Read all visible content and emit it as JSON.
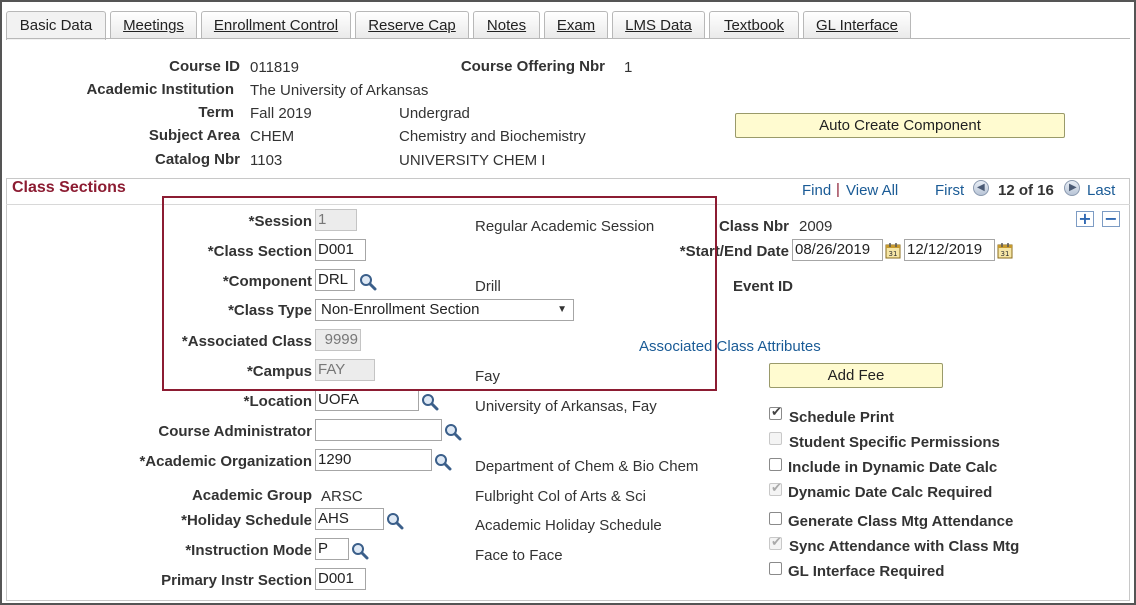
{
  "tabs": [
    {
      "label": "Basic Data",
      "active": true
    },
    {
      "label": "Meetings",
      "active": false
    },
    {
      "label": "Enrollment Control",
      "active": false
    },
    {
      "label": "Reserve Cap",
      "active": false
    },
    {
      "label": "Notes",
      "active": false
    },
    {
      "label": "Exam",
      "active": false
    },
    {
      "label": "LMS Data",
      "active": false
    },
    {
      "label": "Textbook",
      "active": false
    },
    {
      "label": "GL Interface",
      "active": false
    }
  ],
  "header": {
    "course_id_label": "Course ID",
    "course_id": "011819",
    "offering_label": "Course Offering Nbr",
    "offering": "1",
    "institution_label": "Academic Institution",
    "institution": "The University of Arkansas",
    "term_label": "Term",
    "term": "Fall 2019",
    "career": "Undergrad",
    "subject_label": "Subject Area",
    "subject": "CHEM",
    "subject_desc": "Chemistry and Biochemistry",
    "catalog_label": "Catalog Nbr",
    "catalog": "1103",
    "catalog_desc": "UNIVERSITY CHEM I",
    "auto_create_button": "Auto Create Component"
  },
  "class_sections": {
    "title": "Class Sections",
    "find": "Find",
    "separator": "|",
    "view_all": "View All",
    "first": "First",
    "counter": "12 of 16",
    "last": "Last",
    "add_row": "+",
    "delete_row": "−"
  },
  "form": {
    "session_label": "*Session",
    "session_value": "1",
    "session_desc": "Regular Academic Session",
    "class_section_label": "*Class Section",
    "class_section_value": "D001",
    "component_label": "*Component",
    "component_value": "DRL",
    "component_desc": "Drill",
    "class_type_label": "*Class Type",
    "class_type_value": "Non-Enrollment Section",
    "assoc_class_label": "*Associated Class",
    "assoc_class_value": "9999",
    "campus_label": "*Campus",
    "campus_value": "FAY",
    "campus_desc": "Fay",
    "location_label": "*Location",
    "location_value": "UOFA",
    "location_desc": "University of Arkansas, Fay",
    "course_admin_label": "Course Administrator",
    "course_admin_value": "",
    "acad_org_label": "*Academic Organization",
    "acad_org_value": "1290",
    "acad_org_desc": "Department of Chem & Bio Chem",
    "acad_group_label": "Academic Group",
    "acad_group_value": "ARSC",
    "acad_group_desc": "Fulbright Col of Arts & Sci",
    "holiday_label": "*Holiday Schedule",
    "holiday_value": "AHS",
    "holiday_desc": "Academic Holiday Schedule",
    "instr_mode_label": "*Instruction Mode",
    "instr_mode_value": "P",
    "instr_mode_desc": "Face to Face",
    "primary_instr_label": "Primary Instr Section",
    "primary_instr_value": "D001"
  },
  "right": {
    "class_nbr_label": "Class Nbr",
    "class_nbr_value": "2009",
    "dates_label": "*Start/End Date",
    "start_date": "08/26/2019",
    "end_date": "12/12/2019",
    "event_id_label": "Event ID",
    "assoc_attr_link": "Associated Class Attributes",
    "add_fee_button": "Add Fee",
    "checkboxes": [
      {
        "label": "Schedule Print",
        "checked": true,
        "disabled": false
      },
      {
        "label": "Student Specific Permissions",
        "checked": false,
        "disabled": true
      },
      {
        "label": "Include in Dynamic Date Calc",
        "checked": false,
        "disabled": false
      },
      {
        "label": "Dynamic Date Calc Required",
        "checked": true,
        "disabled": true
      },
      {
        "label": "Generate Class Mtg Attendance",
        "checked": false,
        "disabled": false
      },
      {
        "label": "Sync Attendance with Class Mtg",
        "checked": true,
        "disabled": true
      },
      {
        "label": "GL Interface Required",
        "checked": false,
        "disabled": false
      }
    ]
  },
  "colors": {
    "highlight_border": "#8c1c32",
    "section_title": "#8c1c32",
    "link": "#1a5b96",
    "button_yellow": "#fffbd0"
  }
}
